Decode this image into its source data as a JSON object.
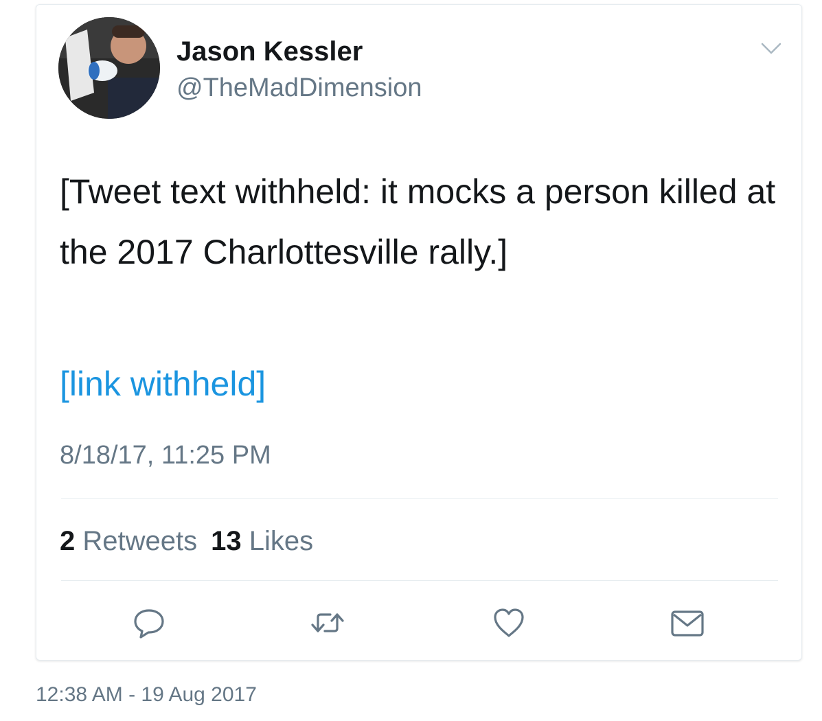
{
  "tweet": {
    "author": {
      "display_name": "Jason Kessler",
      "handle": "@TheMadDimension"
    },
    "body": "[Tweet text withheld: it mocks a person killed at the 2017 Charlottesville rally.]",
    "link_text": "[link withheld]",
    "timestamp": "8/18/17, 11:25 PM",
    "stats": {
      "retweets_count": "2",
      "retweets_label": "Retweets",
      "likes_count": "13",
      "likes_label": "Likes"
    },
    "icons": {
      "menu": "chevron-down-icon",
      "reply": "reply-icon",
      "retweet": "retweet-icon",
      "like": "heart-icon",
      "message": "envelope-icon"
    }
  },
  "capture_time": "12:38 AM - 19 Aug 2017",
  "colors": {
    "link": "#1b95e0",
    "secondary_text": "#657786",
    "primary_text": "#14171a",
    "divider": "#e6ecf0"
  }
}
